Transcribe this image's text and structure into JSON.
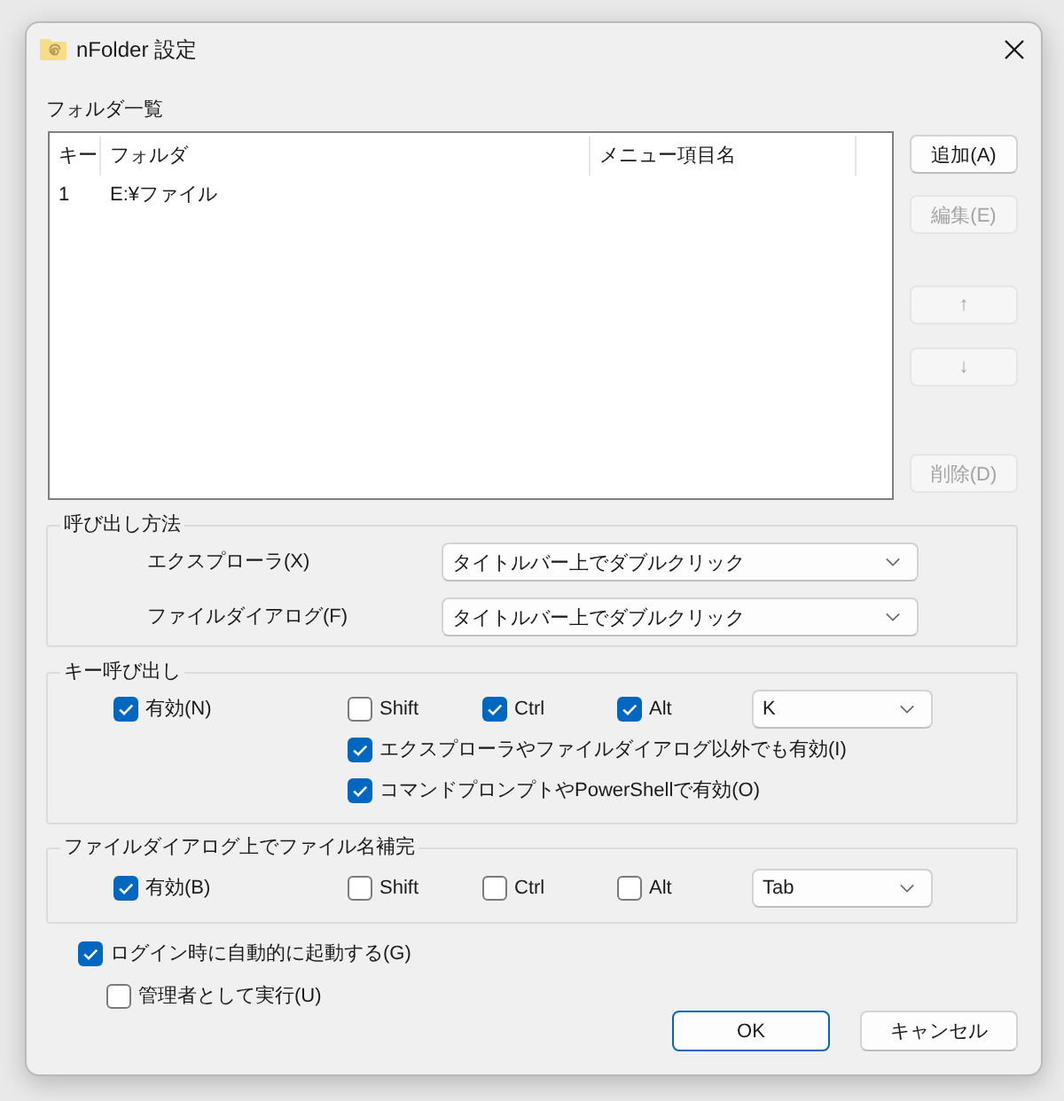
{
  "window": {
    "title": "nFolder 設定"
  },
  "folder_list": {
    "label": "フォルダ一覧",
    "columns": [
      "キー",
      "フォルダ",
      "メニュー項目名"
    ],
    "rows": [
      {
        "key": "1",
        "folder": "E:¥ファイル"
      }
    ]
  },
  "list_buttons": [
    {
      "label": "追加(A)",
      "disabled": false
    },
    {
      "label": "編集(E)",
      "disabled": true
    },
    {
      "label": "↑",
      "disabled": true
    },
    {
      "label": "↓",
      "disabled": true
    },
    {
      "label": "削除(D)",
      "disabled": true
    }
  ],
  "invocation": {
    "title": "呼び出し方法",
    "fields": [
      {
        "label": "エクスプローラ(X)",
        "value": "タイトルバー上でダブルクリック"
      },
      {
        "label": "ファイルダイアログ(F)",
        "value": "タイトルバー上でダブルクリック"
      }
    ]
  },
  "hotkey_groups": [
    {
      "title": "キー呼び出し",
      "enabled": {
        "label": "有効(N)",
        "checked": true
      },
      "modifiers": [
        {
          "label": "Shift",
          "checked": false
        },
        {
          "label": "Ctrl",
          "checked": true
        },
        {
          "label": "Alt",
          "checked": true
        }
      ],
      "key": "K",
      "options": [
        {
          "label": "エクスプローラやファイルダイアログ以外でも有効(I)",
          "checked": true
        },
        {
          "label": "コマンドプロンプトやPowerShellで有効(O)",
          "checked": true
        }
      ]
    },
    {
      "title": "ファイルダイアログ上でファイル名補完",
      "enabled": {
        "label": "有効(B)",
        "checked": true
      },
      "modifiers": [
        {
          "label": "Shift",
          "checked": false
        },
        {
          "label": "Ctrl",
          "checked": false
        },
        {
          "label": "Alt",
          "checked": false
        }
      ],
      "key": "Tab"
    }
  ],
  "startup_options": [
    {
      "label": "ログイン時に自動的に起動する(G)",
      "checked": true,
      "children": [
        {
          "label": "管理者として実行(U)",
          "checked": false
        }
      ]
    }
  ],
  "buttons": [
    {
      "label": "OK",
      "default": true
    },
    {
      "label": "キャンセル",
      "default": false
    }
  ]
}
